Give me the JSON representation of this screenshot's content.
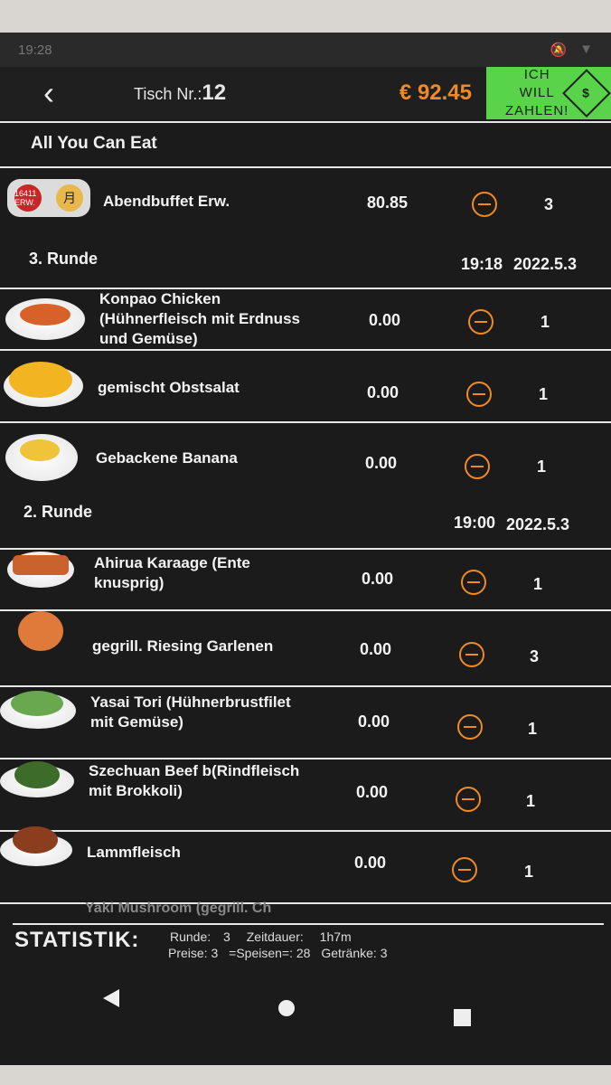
{
  "status": {
    "time": "19:28"
  },
  "header": {
    "table_label": "Tisch Nr.:",
    "table_number": "12",
    "total": "€ 92.45",
    "pay_line1": "ICH WILL",
    "pay_line2": "ZAHLEN!"
  },
  "section": {
    "title": "All You Can Eat"
  },
  "buffet": {
    "logo_text1": "16411 ERW.",
    "logo_text2": "月",
    "name": "Abendbuffet Erw.",
    "price": "80.85",
    "qty": "3"
  },
  "rounds": [
    {
      "label": "3. Runde",
      "time": "19:18",
      "date": "2022.5.3",
      "items": [
        {
          "name": "Konpao Chicken (Hühnerfleisch mit Erdnuss und Gemüse)",
          "price": "0.00",
          "qty": "1"
        },
        {
          "name": "gemischt Obstsalat",
          "price": "0.00",
          "qty": "1"
        },
        {
          "name": "Gebackene Banana",
          "price": "0.00",
          "qty": "1"
        }
      ]
    },
    {
      "label": "2. Runde",
      "time": "19:00",
      "date": "2022.5.3",
      "items": [
        {
          "name": "Ahirua Karaage (Ente knusprig)",
          "price": "0.00",
          "qty": "1"
        },
        {
          "name": "gegrill. Riesing Garlenen",
          "price": "0.00",
          "qty": "3"
        },
        {
          "name": "Yasai Tori (Hühnerbrustfilet mit Gemüse)",
          "price": "0.00",
          "qty": "1"
        },
        {
          "name": "Szechuan Beef b(Rindfleisch mit Brokkoli)",
          "price": "0.00",
          "qty": "1"
        },
        {
          "name": "Lammfleisch",
          "price": "0.00",
          "qty": "1"
        }
      ]
    }
  ],
  "peek_item": "Yaki Mushroom (gegrill. Ch",
  "stats": {
    "title": "STATISTIK:",
    "runde_label": "Runde:",
    "runde_value": "3",
    "zeit_label": "Zeitdauer:",
    "zeit_value": "1h7m",
    "preise": "Preise: 3",
    "speisen": "=Speisen=: 28",
    "getraenke": "Getränke: 3"
  }
}
